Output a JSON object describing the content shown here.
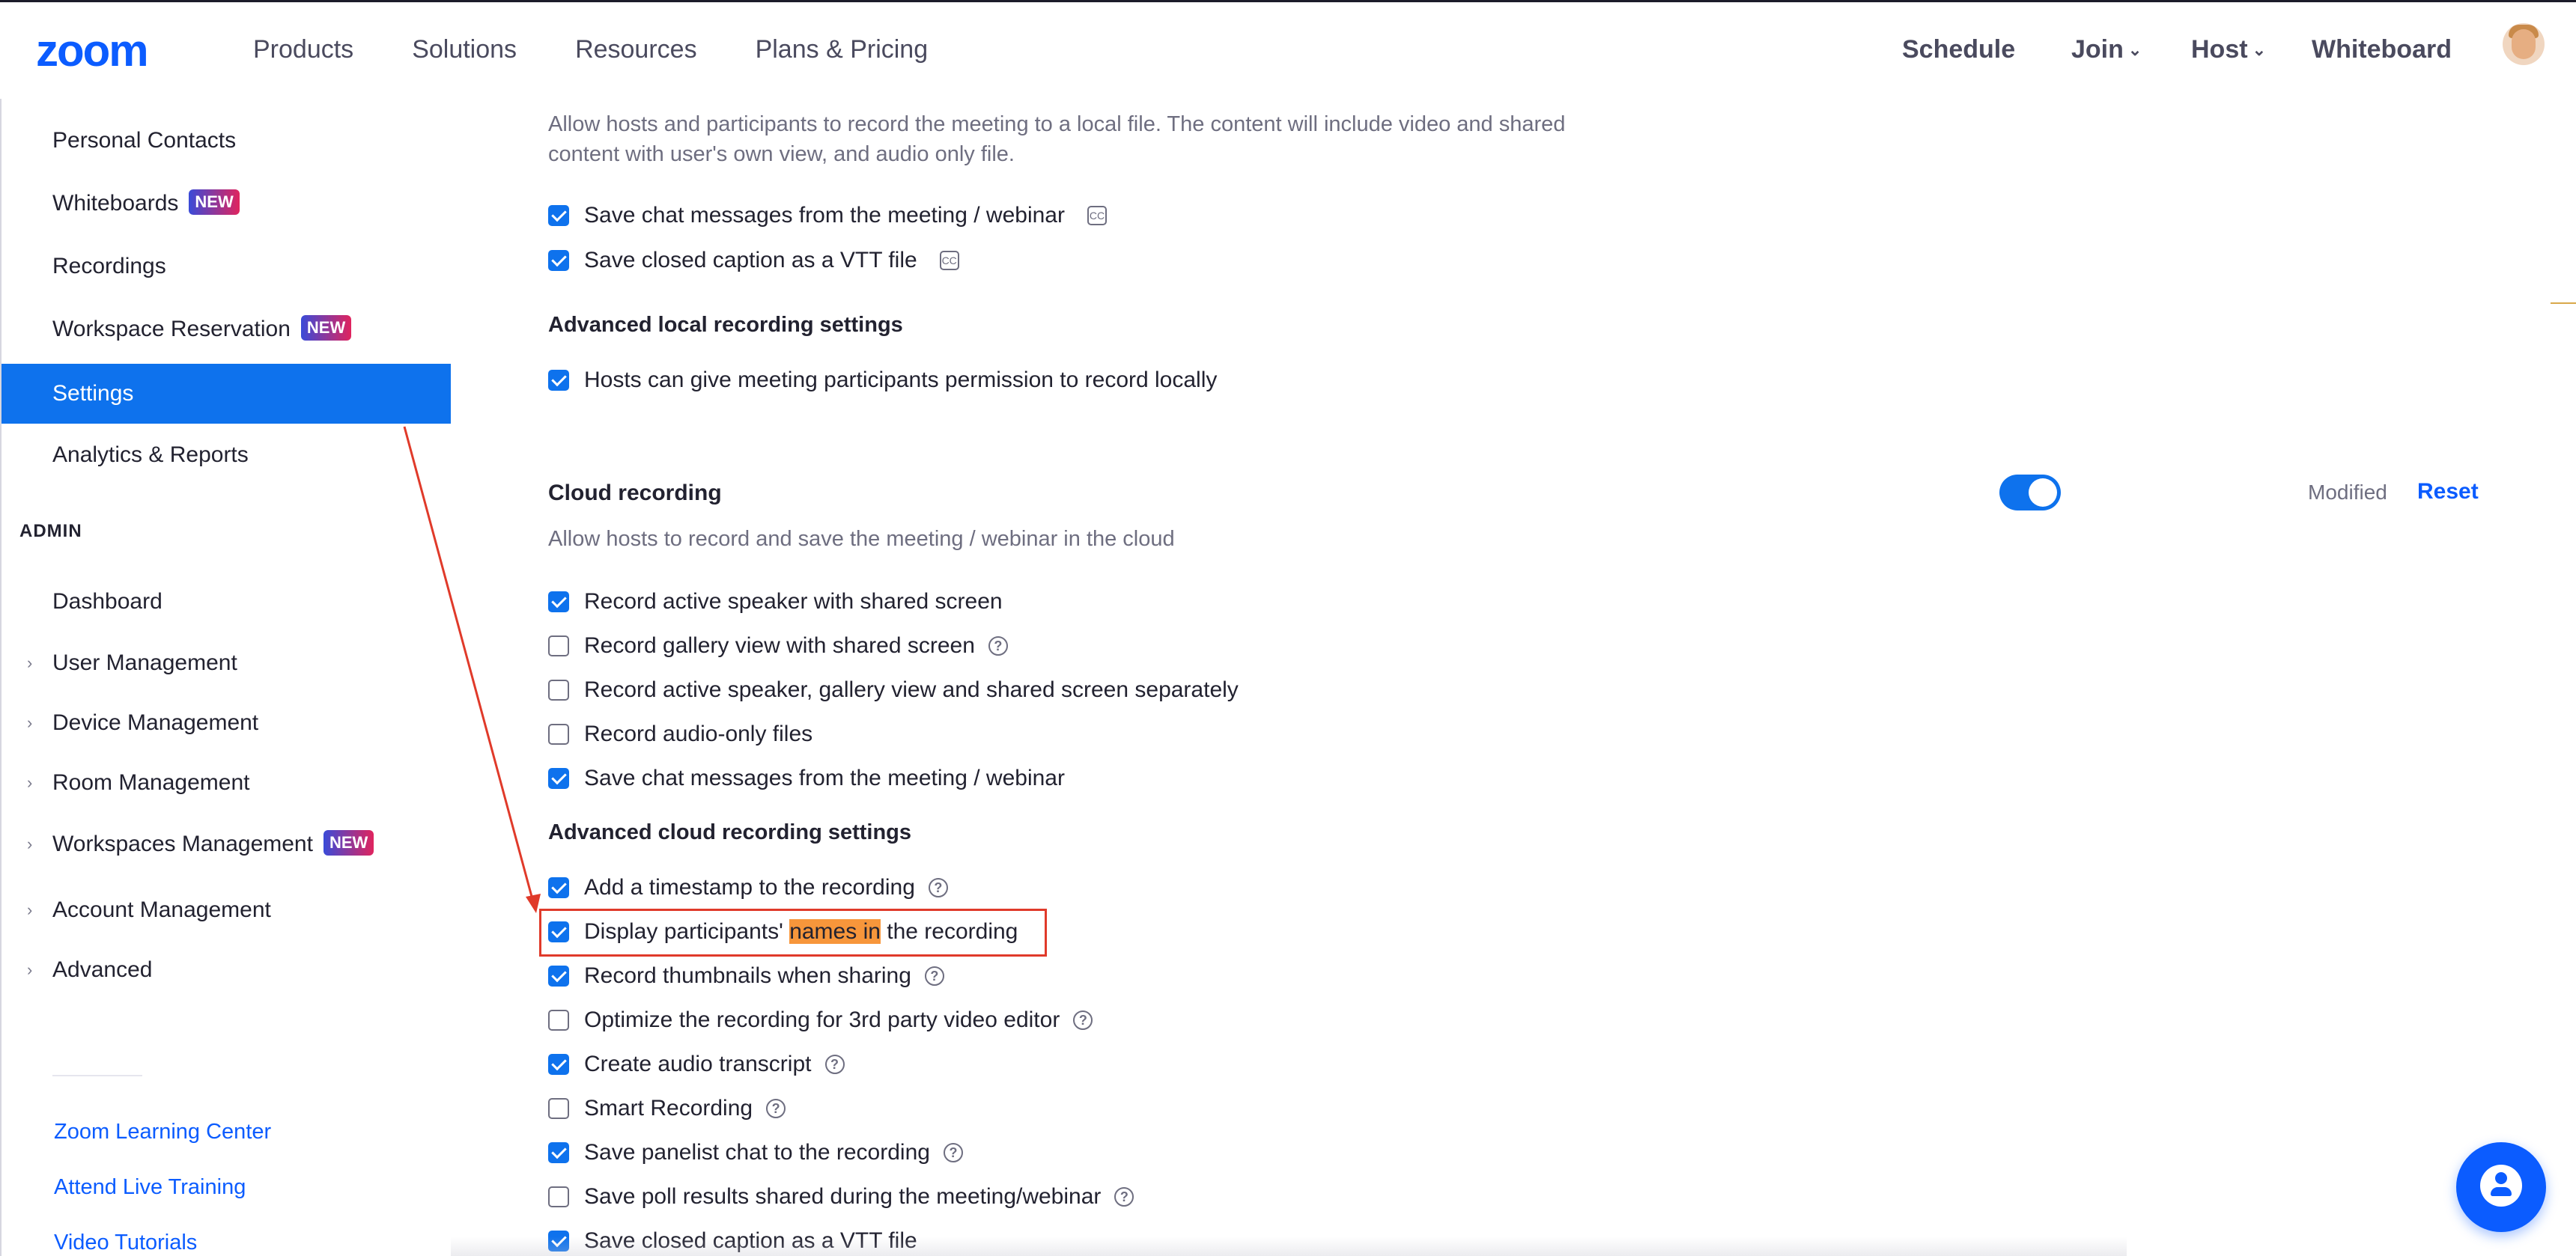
{
  "header": {
    "logo": "zoom",
    "nav_left": [
      "Products",
      "Solutions",
      "Resources",
      "Plans & Pricing"
    ],
    "schedule": "Schedule",
    "join": "Join",
    "host": "Host",
    "whiteboard": "Whiteboard"
  },
  "sidebar": {
    "items": [
      {
        "label": "Personal Contacts"
      },
      {
        "label": "Whiteboards",
        "badge": "NEW"
      },
      {
        "label": "Recordings"
      },
      {
        "label": "Workspace Reservation",
        "badge": "NEW"
      },
      {
        "label": "Settings",
        "active": true
      },
      {
        "label": "Analytics & Reports"
      }
    ],
    "admin_heading": "ADMIN",
    "admin_items": [
      {
        "label": "Dashboard"
      },
      {
        "label": "User Management",
        "expandable": true
      },
      {
        "label": "Device Management",
        "expandable": true
      },
      {
        "label": "Room Management",
        "expandable": true
      },
      {
        "label": "Workspaces Management",
        "expandable": true,
        "badge": "NEW"
      },
      {
        "label": "Account Management",
        "expandable": true
      },
      {
        "label": "Advanced",
        "expandable": true
      }
    ],
    "links": [
      "Zoom Learning Center",
      "Attend Live Training",
      "Video Tutorials"
    ]
  },
  "local_recording": {
    "description": "Allow hosts and participants to record the meeting to a local file. The content will include video and shared content with user's own view, and audio only file.",
    "options": [
      {
        "label": "Save chat messages from the meeting / webinar",
        "checked": true
      },
      {
        "label": "Save closed caption as a VTT file",
        "checked": true
      }
    ],
    "advanced_heading": "Advanced local recording settings",
    "advanced_options": [
      {
        "label": "Hosts can give meeting participants permission to record locally",
        "checked": true
      }
    ]
  },
  "cloud_recording": {
    "title": "Cloud recording",
    "enabled": true,
    "modified": "Modified",
    "reset": "Reset",
    "description": "Allow hosts to record and save the meeting / webinar in the cloud",
    "options": [
      {
        "label": "Record active speaker with shared screen",
        "checked": true
      },
      {
        "label": "Record gallery view with shared screen",
        "checked": false
      },
      {
        "label": "Record active speaker, gallery view and shared screen separately",
        "checked": false
      },
      {
        "label": "Record audio-only files",
        "checked": false
      },
      {
        "label": "Save chat messages from the meeting / webinar",
        "checked": true
      }
    ],
    "advanced_heading": "Advanced cloud recording settings",
    "advanced_options": [
      {
        "label": "Add a timestamp to the recording",
        "checked": true
      },
      {
        "label_before": "Display participants' ",
        "label_highlight": "names in",
        "label_after": " the recording",
        "checked": true
      },
      {
        "label": "Record thumbnails when sharing",
        "checked": true
      },
      {
        "label": "Optimize the recording for 3rd party video editor",
        "checked": false
      },
      {
        "label": "Create audio transcript",
        "checked": true
      },
      {
        "label": "Smart Recording",
        "checked": false
      },
      {
        "label": "Save panelist chat to the recording",
        "checked": true
      },
      {
        "label": "Save poll results shared during the meeting/webinar",
        "checked": false
      },
      {
        "label": "Save closed caption as a VTT file",
        "checked": true
      }
    ]
  },
  "colors": {
    "accent": "#0e72ed",
    "link": "#0b5cff",
    "highlight": "#f7963b",
    "annotation": "#e03a2a"
  },
  "icons": {
    "help": "?",
    "caption": "CC",
    "chevron": "⌄",
    "expand": "›"
  }
}
